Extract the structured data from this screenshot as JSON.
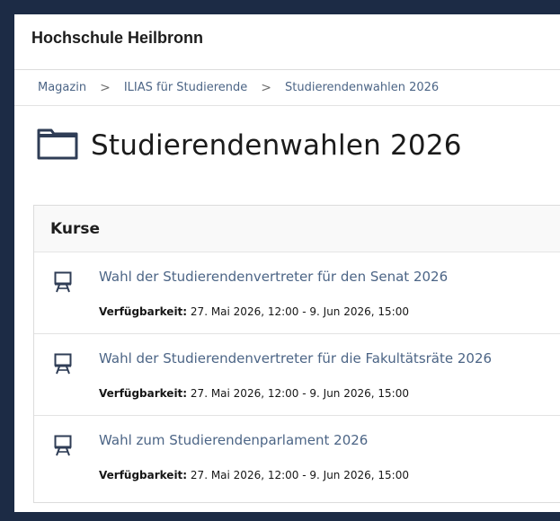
{
  "header": {
    "brand": "Hochschule Heilbronn"
  },
  "breadcrumb": {
    "items": [
      "Magazin",
      "ILIAS für Studierende",
      "Studierendenwahlen 2026"
    ],
    "separator": ">"
  },
  "page": {
    "title": "Studierendenwahlen 2026",
    "icon": "folder-icon"
  },
  "courses": {
    "heading": "Kurse",
    "items": [
      {
        "title": "Wahl der Studierendenvertreter für den Senat 2026",
        "availability_label": "Verfügbarkeit:",
        "availability_value": "27. Mai 2026, 12:00 - 9. Jun 2026, 15:00",
        "icon": "course-icon"
      },
      {
        "title": "Wahl der Studierendenvertreter für die Fakultätsräte 2026",
        "availability_label": "Verfügbarkeit:",
        "availability_value": "27. Mai 2026, 12:00 - 9. Jun 2026, 15:00",
        "icon": "course-icon"
      },
      {
        "title": "Wahl zum Studierendenparlament 2026",
        "availability_label": "Verfügbarkeit:",
        "availability_value": "27. Mai 2026, 12:00 - 9. Jun 2026, 15:00",
        "icon": "course-icon"
      }
    ]
  },
  "colors": {
    "frame": "#1c2b45",
    "link": "#4c6586",
    "text": "#161616",
    "panel_header_bg": "#f9f9f9"
  }
}
